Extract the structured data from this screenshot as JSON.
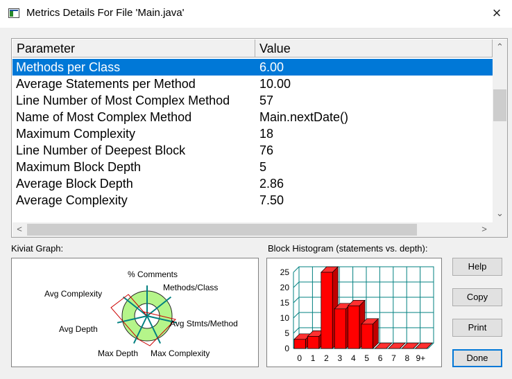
{
  "window": {
    "title": "Metrics Details For File 'Main.java'"
  },
  "table": {
    "headers": {
      "parameter": "Parameter",
      "value": "Value"
    },
    "rows": [
      {
        "parameter": "Methods per Class",
        "value": "6.00",
        "selected": true
      },
      {
        "parameter": "Average Statements per Method",
        "value": "10.00"
      },
      {
        "parameter": "Line Number of Most Complex Method",
        "value": "57"
      },
      {
        "parameter": "Name of Most Complex Method",
        "value": "Main.nextDate()"
      },
      {
        "parameter": "Maximum Complexity",
        "value": "18"
      },
      {
        "parameter": "Line Number of Deepest Block",
        "value": "76"
      },
      {
        "parameter": "Maximum Block Depth",
        "value": "5"
      },
      {
        "parameter": "Average Block Depth",
        "value": "2.86"
      },
      {
        "parameter": "Average Complexity",
        "value": "7.50"
      }
    ]
  },
  "kiviat": {
    "label": "Kiviat Graph:",
    "axes": [
      "% Comments",
      "Methods/Class",
      "Avg Stmts/Method",
      "Max Complexity",
      "Max Depth",
      "Avg Depth",
      "Avg Complexity"
    ]
  },
  "histogram": {
    "label": "Block Histogram (statements vs. depth):",
    "y_ticks": [
      "25",
      "20",
      "15",
      "10",
      "5",
      "0"
    ],
    "chart_data": {
      "type": "bar",
      "categories": [
        "0",
        "1",
        "2",
        "3",
        "4",
        "5",
        "6",
        "7",
        "8",
        "9+"
      ],
      "values": [
        3,
        4,
        25,
        13,
        14,
        8,
        0,
        0,
        0,
        0
      ],
      "ylim": [
        0,
        25
      ],
      "grid": true,
      "bar_color": "#ff0000"
    }
  },
  "buttons": {
    "help": "Help",
    "copy": "Copy",
    "print": "Print",
    "done": "Done"
  },
  "colors": {
    "selection": "#0078d7",
    "kiviat_ring": "#b5f58a",
    "kiviat_axis": "#008080",
    "bar": "#ff0000"
  },
  "icons": {
    "close": "×",
    "up": "⌃",
    "down": "⌄",
    "left": "<",
    "right": ">"
  }
}
